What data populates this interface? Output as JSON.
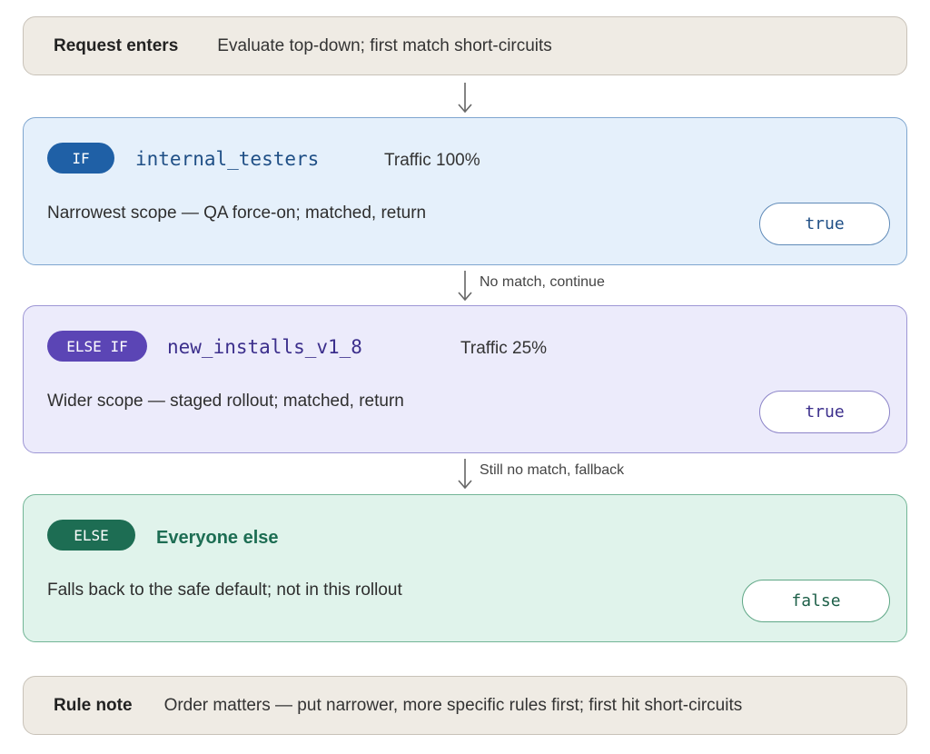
{
  "header": {
    "label": "Request enters",
    "text": "Evaluate top-down; first match short-circuits"
  },
  "rules": [
    {
      "keyword": "IF",
      "name": "internal_testers",
      "traffic": "Traffic 100%",
      "description": "Narrowest scope — QA force-on; matched, return",
      "result": "true"
    },
    {
      "keyword": "ELSE IF",
      "name": "new_installs_v1_8",
      "traffic": "Traffic 25%",
      "description": "Wider scope — staged rollout; matched, return",
      "result": "true"
    },
    {
      "keyword": "ELSE",
      "name": "Everyone else",
      "description": "Falls back to the safe default; not in this rollout",
      "result": "false"
    }
  ],
  "connectors": [
    {
      "label": ""
    },
    {
      "label": "No match, continue"
    },
    {
      "label": "Still no match, fallback"
    }
  ],
  "footer": {
    "label": "Rule note",
    "text": "Order matters — put narrower, more specific rules first; first hit short-circuits"
  },
  "colors": {
    "if_accent": "#1f60a6",
    "else_if_accent": "#5b45b5",
    "else_accent": "#1d6d53"
  },
  "icons": {
    "connector": "down-arrow-icon"
  }
}
